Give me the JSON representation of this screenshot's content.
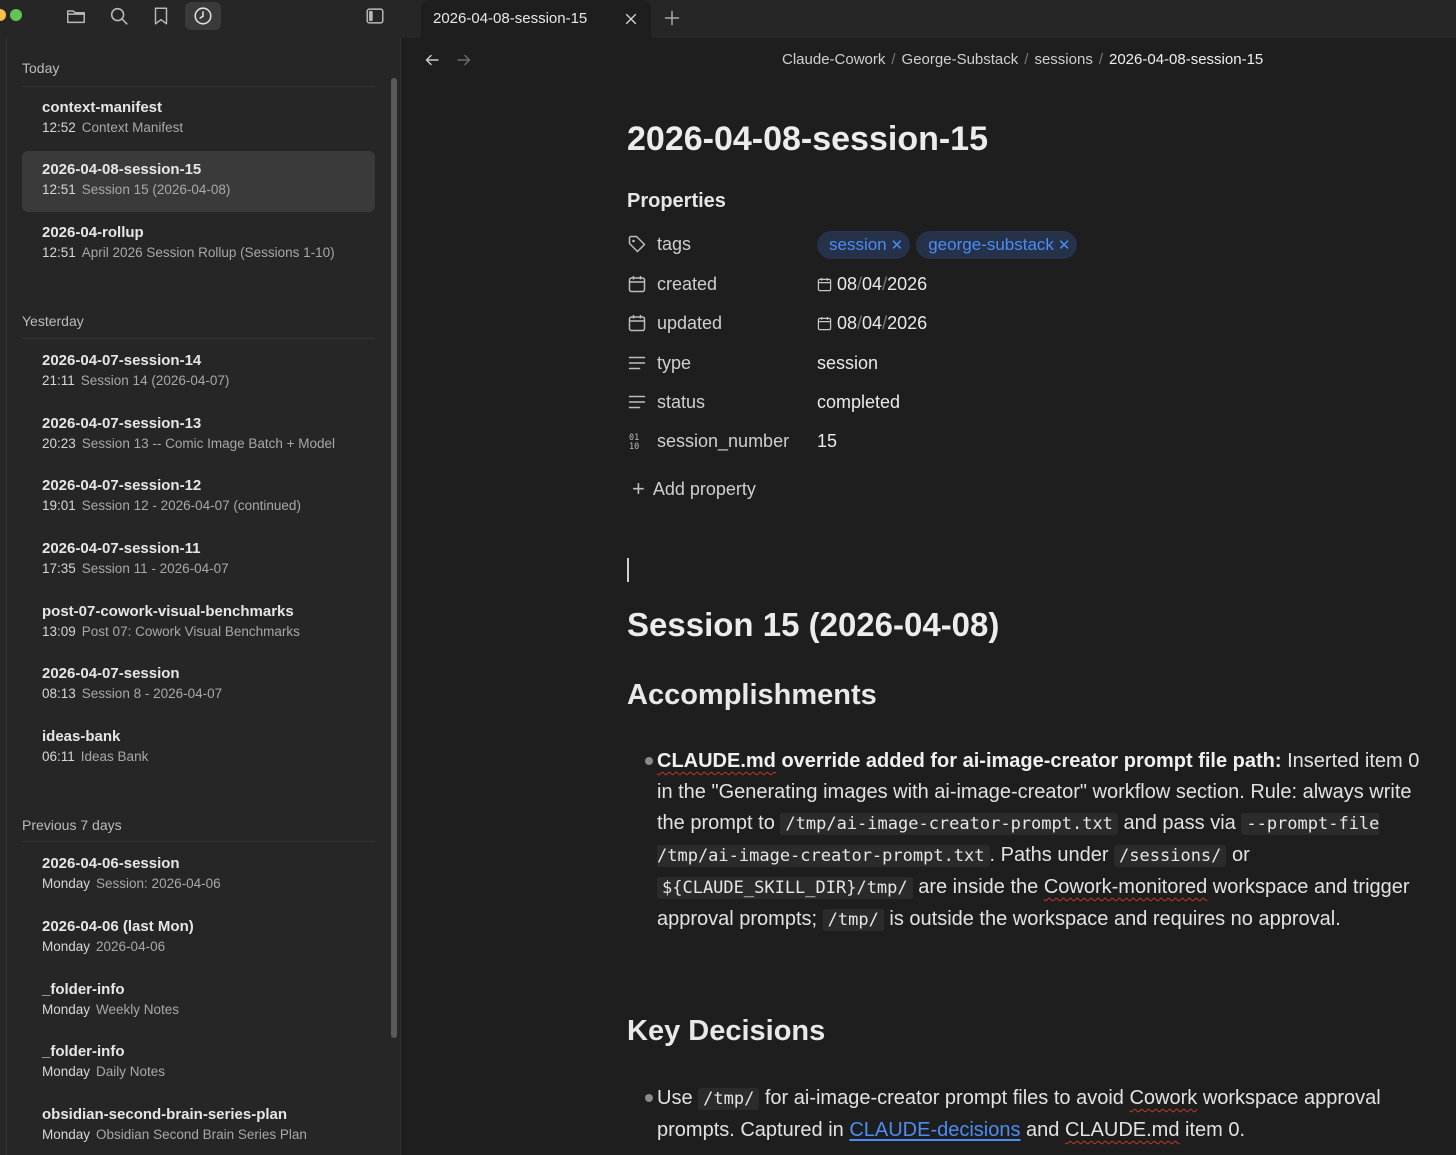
{
  "tab": {
    "title": "2026-04-08-session-15"
  },
  "sidebar": {
    "sections": [
      {
        "label": "Today"
      },
      {
        "label": "Yesterday"
      },
      {
        "label": "Previous 7 days"
      }
    ],
    "items": [
      {
        "title": "context-manifest",
        "time": "12:52",
        "subtitle": "Context Manifest"
      },
      {
        "title": "2026-04-08-session-15",
        "time": "12:51",
        "subtitle": "Session 15 (2026-04-08)"
      },
      {
        "title": "2026-04-rollup",
        "time": "12:51",
        "subtitle": "April 2026 Session Rollup (Sessions 1-10)"
      },
      {
        "title": "2026-04-07-session-14",
        "time": "21:11",
        "subtitle": "Session 14 (2026-04-07)"
      },
      {
        "title": "2026-04-07-session-13",
        "time": "20:23",
        "subtitle": "Session 13 -- Comic Image Batch + Model"
      },
      {
        "title": "2026-04-07-session-12",
        "time": "19:01",
        "subtitle": "Session 12 - 2026-04-07 (continued)"
      },
      {
        "title": "2026-04-07-session-11",
        "time": "17:35",
        "subtitle": "Session 11 - 2026-04-07"
      },
      {
        "title": "post-07-cowork-visual-benchmarks",
        "time": "13:09",
        "subtitle": "Post 07: Cowork Visual Benchmarks"
      },
      {
        "title": "2026-04-07-session",
        "time": "08:13",
        "subtitle": "Session 8 - 2026-04-07"
      },
      {
        "title": "ideas-bank",
        "time": "06:11",
        "subtitle": "Ideas Bank"
      },
      {
        "title": "2026-04-06-session",
        "time": "Monday",
        "subtitle": "Session: 2026-04-06"
      },
      {
        "title": "2026-04-06 (last Mon)",
        "time": "Monday",
        "subtitle": "2026-04-06"
      },
      {
        "title": "_folder-info",
        "time": "Monday",
        "subtitle": "Weekly Notes"
      },
      {
        "title": "_folder-info",
        "time": "Monday",
        "subtitle": "Daily Notes"
      },
      {
        "title": "obsidian-second-brain-series-plan",
        "time": "Monday",
        "subtitle": "Obsidian Second Brain Series Plan"
      }
    ]
  },
  "breadcrumb": [
    "Claude-Cowork",
    "George-Substack",
    "sessions",
    "2026-04-08-session-15"
  ],
  "breadcrumb_sep": "/",
  "note": {
    "title": "2026-04-08-session-15",
    "properties_heading": "Properties",
    "props": {
      "tags": {
        "name": "tags",
        "values": [
          "session",
          "george-substack"
        ]
      },
      "created": {
        "name": "created",
        "day": "08",
        "month": "04",
        "year": "2026"
      },
      "updated": {
        "name": "updated",
        "day": "08",
        "month": "04",
        "year": "2026"
      },
      "type": {
        "name": "type",
        "value": "session"
      },
      "status": {
        "name": "status",
        "value": "completed"
      },
      "session_number": {
        "name": "session_number",
        "value": "15"
      }
    },
    "add_property": "Add property",
    "h1": "Session 15 (2026-04-08)",
    "accomplishments": {
      "heading": "Accomplishments",
      "bold_part1": "CLAUDE.md",
      "bold_part2": " override added for ai-image-creator prompt file path:",
      "t1": " Inserted item 0 in the \"Generating images with ai-image-creator\" workflow section. Rule: always write the prompt to ",
      "c1": "/tmp/ai-image-creator-prompt.txt",
      "t2": " and pass via ",
      "c2": "--prompt-file /tmp/ai-image-creator-prompt.txt",
      "t3": ". Paths under ",
      "c3": "/sessions/",
      "t4": " or ",
      "c4": "${CLAUDE_SKILL_DIR}/tmp/",
      "t5": " are inside the ",
      "t5b": "Cowork-monitored",
      "t6": " workspace and trigger approval prompts; ",
      "c5": "/tmp/",
      "t7": " is outside the workspace and requires no approval."
    },
    "decisions": {
      "heading": "Key Decisions",
      "t1": "Use ",
      "c1": "/tmp/",
      "t2": " for ai-image-creator prompt files to avoid ",
      "t2b": "Cowork",
      "t3": " workspace approval prompts. Captured in ",
      "link": "CLAUDE-decisions",
      "t4": " and ",
      "t4b": "CLAUDE.md",
      "t5": " item 0."
    }
  },
  "colors": {
    "accent": "#4c8cf5",
    "tag_bg": "#25324a",
    "background": "#1e1e1e",
    "sidebar": "#262626"
  }
}
